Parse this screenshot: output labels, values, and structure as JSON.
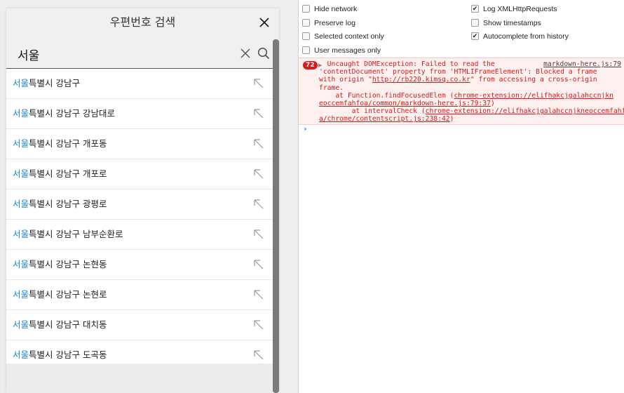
{
  "popup": {
    "title": "우편번호 검색",
    "search_value": "서울",
    "highlight": "서울",
    "results": [
      {
        "rest": "특별시 강남구"
      },
      {
        "rest": "특별시 강남구 강남대로"
      },
      {
        "rest": "특별시 강남구 개포동"
      },
      {
        "rest": "특별시 강남구 개포로"
      },
      {
        "rest": "특별시 강남구 광평로"
      },
      {
        "rest": "특별시 강남구 남부순환로"
      },
      {
        "rest": "특별시 강남구 논현동"
      },
      {
        "rest": "특별시 강남구 논현로"
      },
      {
        "rest": "특별시 강남구 대치동"
      },
      {
        "rest": "특별시 강남구 도곡동"
      }
    ]
  },
  "console": {
    "settings": {
      "hide_network": {
        "label": "Hide network",
        "checked": false
      },
      "preserve_log": {
        "label": "Preserve log",
        "checked": false
      },
      "selected_context_only": {
        "label": "Selected context only",
        "checked": false
      },
      "user_messages_only": {
        "label": "User messages only",
        "checked": false
      },
      "log_xhr": {
        "label": "Log XMLHttpRequests",
        "checked": true
      },
      "show_timestamps": {
        "label": "Show timestamps",
        "checked": false
      },
      "autocomplete_history": {
        "label": "Autocomplete from history",
        "checked": true
      }
    },
    "error": {
      "count": "72",
      "source_link": "markdown-here.js:79",
      "line1": "Uncaught DOMException: Failed to read the",
      "line2": "'contentDocument' property from 'HTMLIFrameElement': Blocked a frame",
      "line3_pre": "with origin \"",
      "line3_link": "http://rb220.kimsq.co.kr",
      "line3_post": "\" from accessing a cross-origin",
      "line4": "frame.",
      "line5_pre": "    at Function.findFocusedElem (",
      "line5_link": "chrome-extension://elifhakcjgalahccnjkn",
      "line6_link": "eoccemfahfoa/common/markdown-here.js:79:37",
      "line6_post": ")",
      "line7_pre": "    at intervalCheck (",
      "line7_link": "chrome-extension://elifhakcjgalahccnjkneoccemfahfo",
      "line8_link": "a/chrome/contentscript.js:238:42",
      "line8_post": ")"
    },
    "prompt_symbol": "›"
  }
}
